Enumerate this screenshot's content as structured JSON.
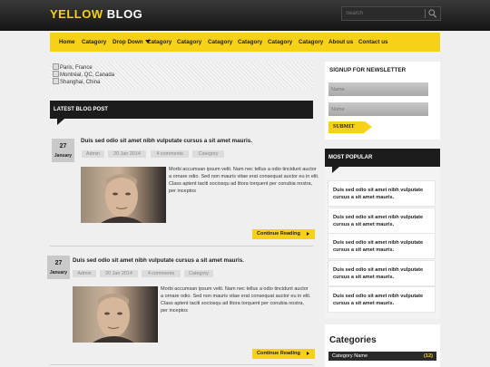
{
  "header": {
    "logo_yellow": "YELLOW",
    "logo_white": "BLOG",
    "search_placeholder": "Search",
    "search_icon": "magnifier-icon"
  },
  "nav": {
    "items": [
      "Home",
      "Catagory",
      "Drop Down",
      "Catagory",
      "Catagory",
      "Catagory",
      "Catagory",
      "Catagory",
      "Catagory",
      "About us",
      "Contact us"
    ]
  },
  "image_alts": [
    "Paris, France",
    "Montréal, QC, Canada",
    "Shanghai, China"
  ],
  "latest": {
    "heading": "LATEST BLOG POST"
  },
  "posts": [
    {
      "day": "27",
      "month": "January",
      "title": "Duis sed odio sit amet nibh vulputate cursus a sit amet mauris.",
      "meta": [
        "Admin",
        "20 Jan 2014",
        "4 comments",
        "Category"
      ],
      "excerpt": "Morbi accumsan ipsum velit. Nam nec tellus a odio tincidunt auctor a ornare odio. Sed non mauris vitae erat consequat auctor eu in elit. Class aptent taciti sociosqu ad litora torquent per conubia nostra, per inceptos",
      "more": "Continue Reading"
    },
    {
      "day": "27",
      "month": "January",
      "title": "Duis sed odio sit amet nibh vulputate cursus a sit amet mauris.",
      "meta": [
        "Admin",
        "20 Jan 2014",
        "4 comments",
        "Category"
      ],
      "excerpt": "Morbi accumsan ipsum velit. Nam nec tellus a odio tincidunt auctor a ornare odio. Sed non mauris vitae erat consequat auctor eu in elit. Class aptent taciti sociosqu ad litora torquent per conubia nostra, per inceptos",
      "more": "Continue Reading"
    }
  ],
  "newsletter": {
    "title": "SIGNUP FOR NEWSLETTER",
    "name_placeholder": "Name",
    "email_placeholder": "Name",
    "submit": "SUBMIT"
  },
  "popular": {
    "heading": "MOST POPULAR",
    "items": [
      "Duis sed odio sit amet nibh vulputate cursus a sit amet mauris.",
      "Duis sed odio sit amet nibh vulputate cursus a sit amet mauris.",
      "Duis sed odio sit amet nibh vulputate cursus a sit amet mauris.",
      "Duis sed odio sit amet nibh vulputate cursus a sit amet mauris.",
      "Duis sed odio sit amet nibh vulputate cursus a sit amet mauris."
    ]
  },
  "categories": {
    "heading": "Categories",
    "items": [
      {
        "name": "Category Name",
        "count": "(12)"
      }
    ]
  },
  "colors": {
    "accent": "#f7d117",
    "dark": "#1c1c1c"
  }
}
